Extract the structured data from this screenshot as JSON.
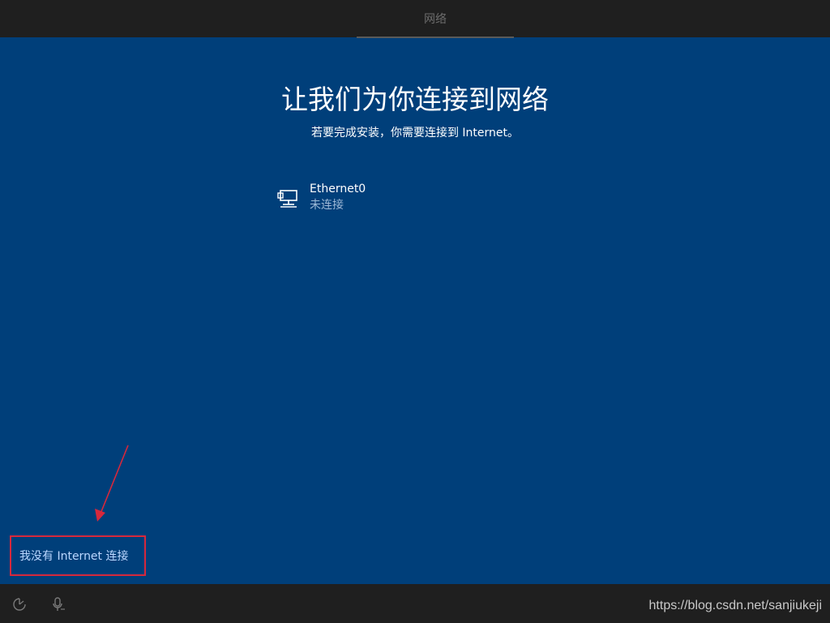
{
  "header": {
    "title": "网络"
  },
  "main": {
    "title": "让我们为你连接到网络",
    "subtitle": "若要完成安装，你需要连接到 Internet。",
    "networks": [
      {
        "name": "Ethernet0",
        "status": "未连接",
        "icon": "ethernet-icon"
      }
    ]
  },
  "footer": {
    "no_internet_label": "我没有 Internet 连接",
    "watermark": "https://blog.csdn.net/sanjiukeji",
    "icons": [
      "ease-of-access-icon",
      "microphone-icon"
    ]
  },
  "colors": {
    "background": "#003f7a",
    "bar": "#1f1f1f",
    "link": "#bcd7ff",
    "highlight": "#d7283c"
  }
}
